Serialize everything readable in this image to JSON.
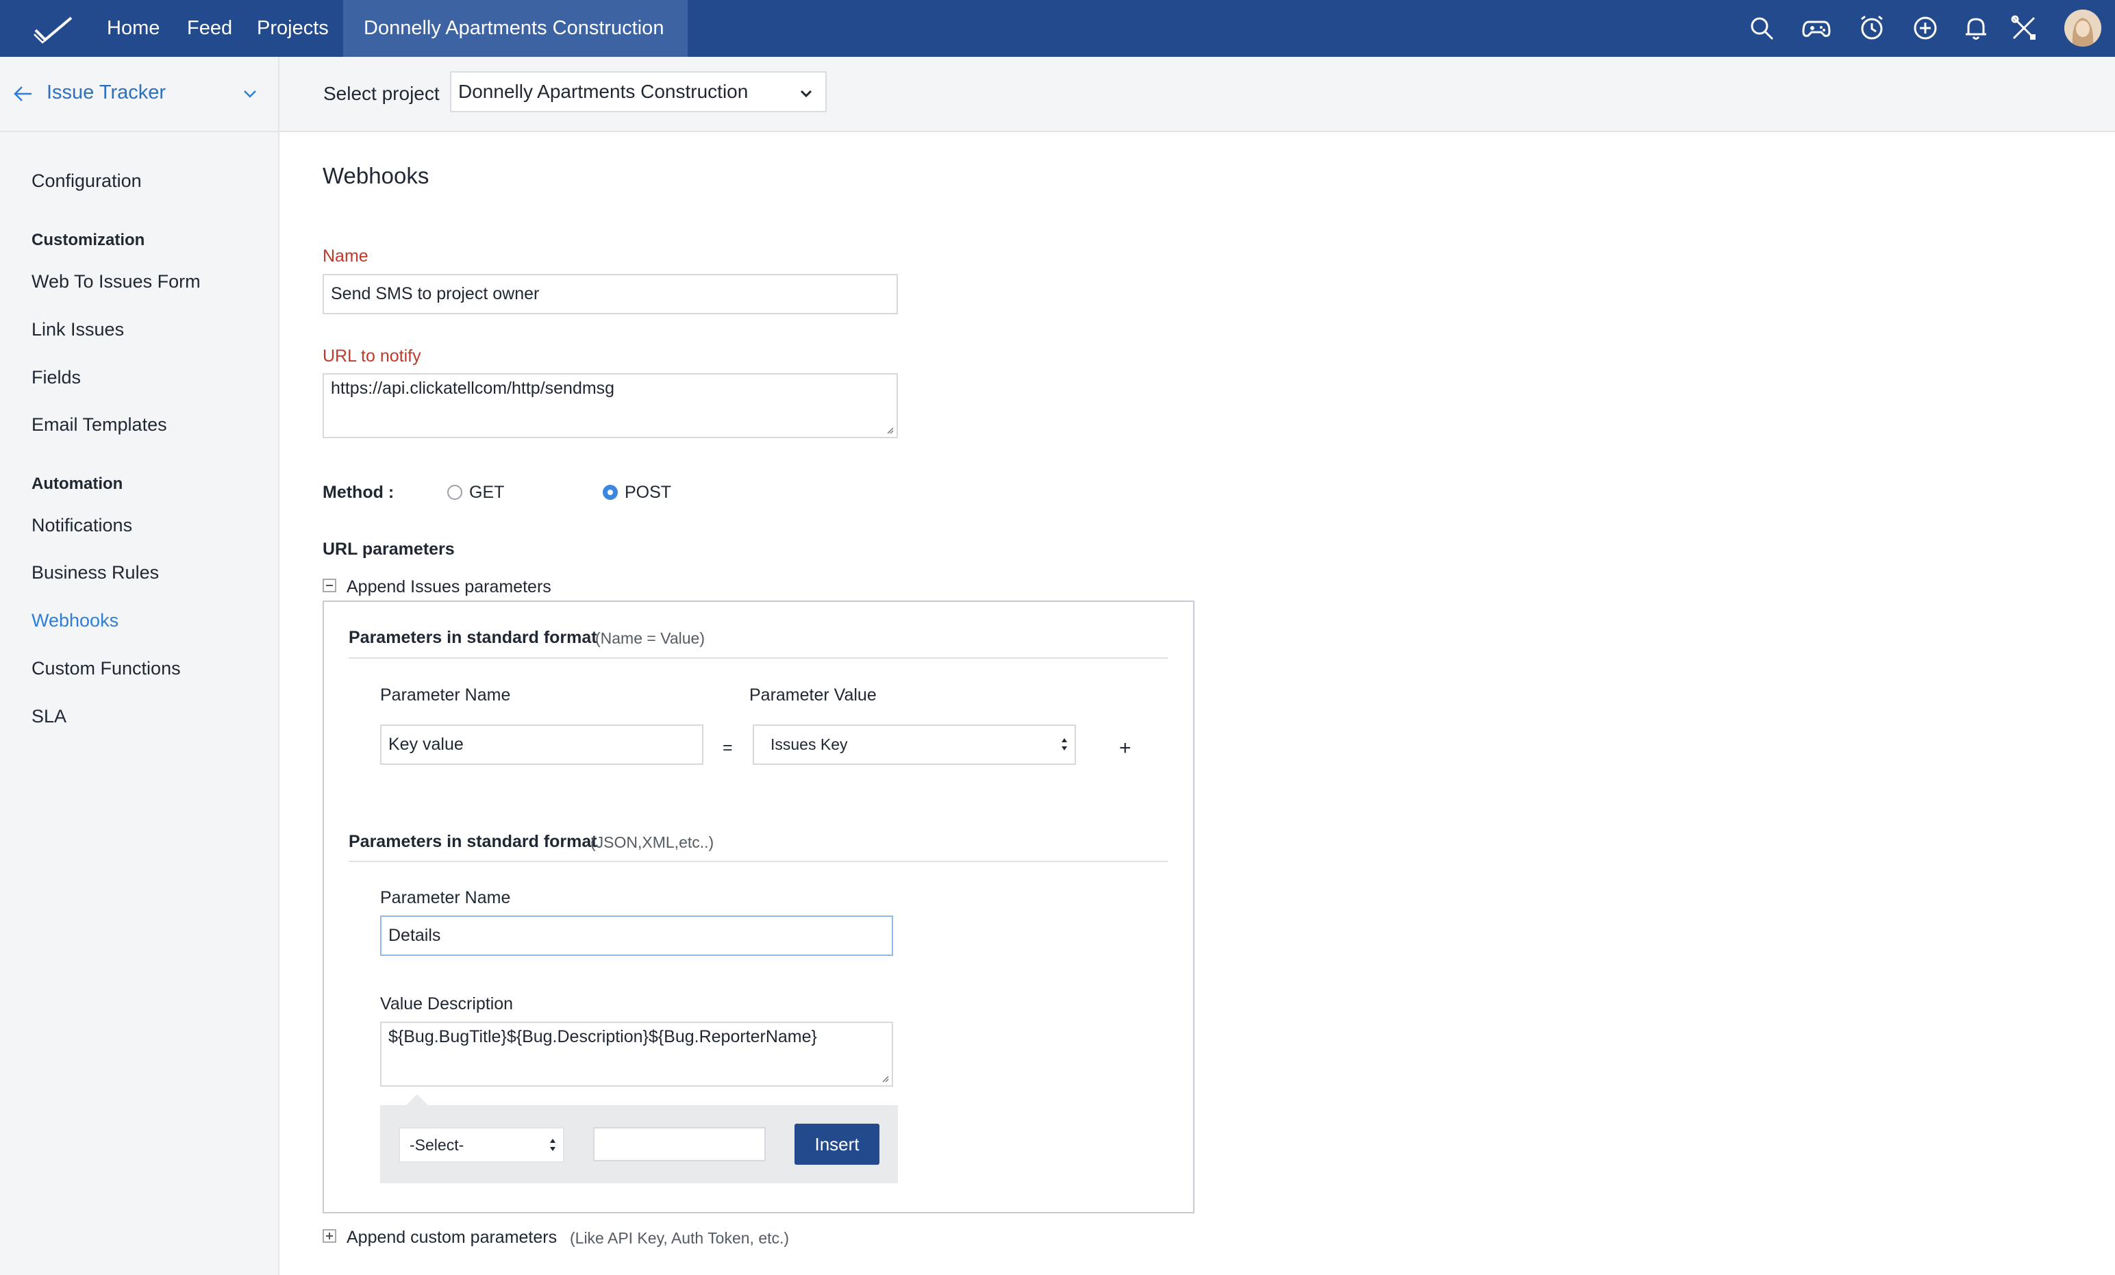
{
  "topbar": {
    "nav": [
      "Home",
      "Feed",
      "Projects"
    ],
    "active_project": "Donnelly Apartments Construction",
    "icons": [
      "search-icon",
      "gamepad-icon",
      "clock-icon",
      "add-circle-icon",
      "bell-icon",
      "tools-icon"
    ],
    "brand_color": "#234a8d"
  },
  "sidebar": {
    "title": "Issue Tracker",
    "items": [
      "Configuration"
    ],
    "groups": [
      {
        "label": "Customization",
        "items": [
          "Web To Issues Form",
          "Link Issues",
          "Fields",
          "Email Templates"
        ]
      },
      {
        "label": "Automation",
        "items": [
          "Notifications",
          "Business Rules",
          "Webhooks",
          "Custom Functions",
          "SLA"
        ]
      }
    ],
    "active_item": "Webhooks",
    "active_color": "#2d7ed6"
  },
  "header": {
    "select_label": "Select project",
    "select_value": "Donnelly Apartments Construction"
  },
  "main": {
    "title": "Webhooks",
    "name_label": "Name",
    "name_value": "Send SMS to project owner",
    "url_label": "URL to notify",
    "url_value": "https://api.clickatellcom/http/sendmsg",
    "method_label": "Method :",
    "methods": [
      "GET",
      "POST"
    ],
    "selected_method": "POST",
    "url_params_label": "URL parameters",
    "append_issues_label": "Append Issues parameters",
    "standard": {
      "title": "Parameters in standard format",
      "hint": "(Name = Value)",
      "param_name_label": "Parameter Name",
      "param_value_label": "Parameter Value",
      "param_name_value": "Key value",
      "equals": "=",
      "param_value_selected": "Issues Key",
      "add": "+"
    },
    "custom_format": {
      "title": "Parameters in standard format",
      "hint": "(JSON,XML,etc..)",
      "param_name_label": "Parameter Name",
      "param_name_value": "Details",
      "value_desc_label": "Value Description",
      "value_desc_value": "${Bug.BugTitle}${Bug.Description}${Bug.ReporterName}",
      "select_value": "-Select-",
      "insert_label": "Insert"
    },
    "append_custom_label": "Append custom parameters",
    "append_custom_hint": "(Like API Key, Auth Token, etc.)"
  }
}
